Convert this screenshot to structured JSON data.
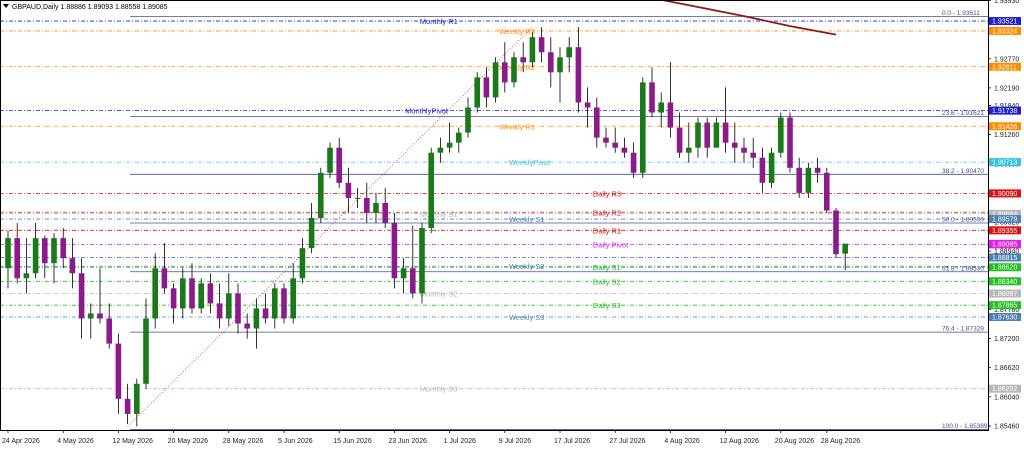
{
  "header": {
    "title": "GBPAUD,Daily  1.88886 1.89093 1.88558 1.89085"
  },
  "chart_data": {
    "type": "candlestick",
    "symbol": "GBPAUD",
    "timeframe": "Daily",
    "ylim": [
      1.8538,
      1.9394
    ],
    "y_ticks": [
      "1.93930",
      "1.93350",
      "1.92770",
      "1.92190",
      "1.91840",
      "1.91260",
      "1.90680",
      "1.90100",
      "1.89520",
      "1.88940",
      "1.88360",
      "1.87780",
      "1.87200",
      "1.86620",
      "1.86040",
      "1.85460"
    ],
    "x_labels": [
      "24 Apr 2026",
      "4 May 2026",
      "12 May 2026",
      "20 May 2026",
      "28 May 2026",
      "5 Jun 2026",
      "15 Jun 2026",
      "23 Jun 2026",
      "1 Jul 2026",
      "9 Jul 2026",
      "17 Jul 2026",
      "27 Jul 2026",
      "4 Aug 2026",
      "12 Aug 2026",
      "20 Aug 2026",
      "28 Aug 2026"
    ],
    "candles": [
      {
        "o": 1.886,
        "h": 1.8935,
        "l": 1.882,
        "c": 1.892
      },
      {
        "o": 1.892,
        "h": 1.895,
        "l": 1.883,
        "c": 1.884
      },
      {
        "o": 1.884,
        "h": 1.892,
        "l": 1.881,
        "c": 1.885
      },
      {
        "o": 1.885,
        "h": 1.895,
        "l": 1.884,
        "c": 1.892
      },
      {
        "o": 1.892,
        "h": 1.8925,
        "l": 1.884,
        "c": 1.887
      },
      {
        "o": 1.887,
        "h": 1.893,
        "l": 1.883,
        "c": 1.892
      },
      {
        "o": 1.892,
        "h": 1.894,
        "l": 1.886,
        "c": 1.888
      },
      {
        "o": 1.888,
        "h": 1.892,
        "l": 1.882,
        "c": 1.885
      },
      {
        "o": 1.885,
        "h": 1.888,
        "l": 1.872,
        "c": 1.876
      },
      {
        "o": 1.876,
        "h": 1.879,
        "l": 1.872,
        "c": 1.877
      },
      {
        "o": 1.877,
        "h": 1.886,
        "l": 1.875,
        "c": 1.876
      },
      {
        "o": 1.876,
        "h": 1.879,
        "l": 1.87,
        "c": 1.871
      },
      {
        "o": 1.871,
        "h": 1.873,
        "l": 1.857,
        "c": 1.86
      },
      {
        "o": 1.86,
        "h": 1.863,
        "l": 1.855,
        "c": 1.857
      },
      {
        "o": 1.857,
        "h": 1.864,
        "l": 1.8545,
        "c": 1.863
      },
      {
        "o": 1.863,
        "h": 1.88,
        "l": 1.862,
        "c": 1.876
      },
      {
        "o": 1.876,
        "h": 1.889,
        "l": 1.874,
        "c": 1.886
      },
      {
        "o": 1.886,
        "h": 1.891,
        "l": 1.881,
        "c": 1.882
      },
      {
        "o": 1.882,
        "h": 1.883,
        "l": 1.875,
        "c": 1.878
      },
      {
        "o": 1.878,
        "h": 1.886,
        "l": 1.876,
        "c": 1.884
      },
      {
        "o": 1.884,
        "h": 1.887,
        "l": 1.877,
        "c": 1.878
      },
      {
        "o": 1.878,
        "h": 1.884,
        "l": 1.877,
        "c": 1.883
      },
      {
        "o": 1.883,
        "h": 1.885,
        "l": 1.877,
        "c": 1.879
      },
      {
        "o": 1.879,
        "h": 1.883,
        "l": 1.874,
        "c": 1.876
      },
      {
        "o": 1.876,
        "h": 1.885,
        "l": 1.8745,
        "c": 1.881
      },
      {
        "o": 1.881,
        "h": 1.883,
        "l": 1.873,
        "c": 1.875
      },
      {
        "o": 1.875,
        "h": 1.877,
        "l": 1.872,
        "c": 1.874
      },
      {
        "o": 1.874,
        "h": 1.88,
        "l": 1.87,
        "c": 1.878
      },
      {
        "o": 1.878,
        "h": 1.881,
        "l": 1.875,
        "c": 1.876
      },
      {
        "o": 1.876,
        "h": 1.883,
        "l": 1.874,
        "c": 1.882
      },
      {
        "o": 1.882,
        "h": 1.883,
        "l": 1.875,
        "c": 1.876
      },
      {
        "o": 1.876,
        "h": 1.887,
        "l": 1.875,
        "c": 1.884
      },
      {
        "o": 1.884,
        "h": 1.892,
        "l": 1.883,
        "c": 1.89
      },
      {
        "o": 1.89,
        "h": 1.899,
        "l": 1.889,
        "c": 1.896
      },
      {
        "o": 1.896,
        "h": 1.906,
        "l": 1.895,
        "c": 1.905
      },
      {
        "o": 1.905,
        "h": 1.911,
        "l": 1.904,
        "c": 1.91
      },
      {
        "o": 1.91,
        "h": 1.912,
        "l": 1.902,
        "c": 1.903
      },
      {
        "o": 1.903,
        "h": 1.906,
        "l": 1.897,
        "c": 1.9
      },
      {
        "o": 1.9,
        "h": 1.902,
        "l": 1.898,
        "c": 1.9
      },
      {
        "o": 1.9,
        "h": 1.903,
        "l": 1.895,
        "c": 1.897
      },
      {
        "o": 1.897,
        "h": 1.901,
        "l": 1.895,
        "c": 1.899
      },
      {
        "o": 1.899,
        "h": 1.902,
        "l": 1.894,
        "c": 1.895
      },
      {
        "o": 1.895,
        "h": 1.897,
        "l": 1.882,
        "c": 1.884
      },
      {
        "o": 1.884,
        "h": 1.888,
        "l": 1.881,
        "c": 1.886
      },
      {
        "o": 1.886,
        "h": 1.8945,
        "l": 1.88,
        "c": 1.881
      },
      {
        "o": 1.881,
        "h": 1.895,
        "l": 1.879,
        "c": 1.894
      },
      {
        "o": 1.894,
        "h": 1.91,
        "l": 1.893,
        "c": 1.909
      },
      {
        "o": 1.909,
        "h": 1.912,
        "l": 1.907,
        "c": 1.91
      },
      {
        "o": 1.91,
        "h": 1.915,
        "l": 1.909,
        "c": 1.911
      },
      {
        "o": 1.911,
        "h": 1.914,
        "l": 1.909,
        "c": 1.913
      },
      {
        "o": 1.913,
        "h": 1.92,
        "l": 1.912,
        "c": 1.918
      },
      {
        "o": 1.918,
        "h": 1.925,
        "l": 1.917,
        "c": 1.924
      },
      {
        "o": 1.924,
        "h": 1.926,
        "l": 1.918,
        "c": 1.92
      },
      {
        "o": 1.92,
        "h": 1.928,
        "l": 1.919,
        "c": 1.927
      },
      {
        "o": 1.927,
        "h": 1.931,
        "l": 1.921,
        "c": 1.923
      },
      {
        "o": 1.923,
        "h": 1.929,
        "l": 1.922,
        "c": 1.928
      },
      {
        "o": 1.928,
        "h": 1.931,
        "l": 1.925,
        "c": 1.927
      },
      {
        "o": 1.927,
        "h": 1.933,
        "l": 1.926,
        "c": 1.932
      },
      {
        "o": 1.932,
        "h": 1.934,
        "l": 1.927,
        "c": 1.929
      },
      {
        "o": 1.929,
        "h": 1.932,
        "l": 1.922,
        "c": 1.925
      },
      {
        "o": 1.925,
        "h": 1.93,
        "l": 1.919,
        "c": 1.928
      },
      {
        "o": 1.928,
        "h": 1.932,
        "l": 1.925,
        "c": 1.93
      },
      {
        "o": 1.93,
        "h": 1.934,
        "l": 1.917,
        "c": 1.919
      },
      {
        "o": 1.919,
        "h": 1.922,
        "l": 1.914,
        "c": 1.918
      },
      {
        "o": 1.918,
        "h": 1.92,
        "l": 1.91,
        "c": 1.912
      },
      {
        "o": 1.912,
        "h": 1.914,
        "l": 1.91,
        "c": 1.911
      },
      {
        "o": 1.911,
        "h": 1.914,
        "l": 1.909,
        "c": 1.91
      },
      {
        "o": 1.91,
        "h": 1.912,
        "l": 1.908,
        "c": 1.909
      },
      {
        "o": 1.909,
        "h": 1.911,
        "l": 1.904,
        "c": 1.905
      },
      {
        "o": 1.905,
        "h": 1.924,
        "l": 1.904,
        "c": 1.923
      },
      {
        "o": 1.923,
        "h": 1.926,
        "l": 1.916,
        "c": 1.917
      },
      {
        "o": 1.917,
        "h": 1.921,
        "l": 1.914,
        "c": 1.919
      },
      {
        "o": 1.919,
        "h": 1.927,
        "l": 1.912,
        "c": 1.914
      },
      {
        "o": 1.914,
        "h": 1.917,
        "l": 1.908,
        "c": 1.909
      },
      {
        "o": 1.909,
        "h": 1.915,
        "l": 1.907,
        "c": 1.91
      },
      {
        "o": 1.91,
        "h": 1.916,
        "l": 1.908,
        "c": 1.915
      },
      {
        "o": 1.915,
        "h": 1.916,
        "l": 1.908,
        "c": 1.91
      },
      {
        "o": 1.91,
        "h": 1.916,
        "l": 1.91,
        "c": 1.915
      },
      {
        "o": 1.915,
        "h": 1.922,
        "l": 1.909,
        "c": 1.911
      },
      {
        "o": 1.911,
        "h": 1.915,
        "l": 1.907,
        "c": 1.91
      },
      {
        "o": 1.91,
        "h": 1.912,
        "l": 1.907,
        "c": 1.909
      },
      {
        "o": 1.909,
        "h": 1.912,
        "l": 1.906,
        "c": 1.908
      },
      {
        "o": 1.908,
        "h": 1.91,
        "l": 1.901,
        "c": 1.903
      },
      {
        "o": 1.903,
        "h": 1.91,
        "l": 1.902,
        "c": 1.909
      },
      {
        "o": 1.909,
        "h": 1.917,
        "l": 1.908,
        "c": 1.916
      },
      {
        "o": 1.916,
        "h": 1.917,
        "l": 1.905,
        "c": 1.906
      },
      {
        "o": 1.906,
        "h": 1.908,
        "l": 1.9,
        "c": 1.901
      },
      {
        "o": 1.901,
        "h": 1.907,
        "l": 1.9,
        "c": 1.906
      },
      {
        "o": 1.906,
        "h": 1.908,
        "l": 1.903,
        "c": 1.905
      },
      {
        "o": 1.905,
        "h": 1.906,
        "l": 1.897,
        "c": 1.8975
      },
      {
        "o": 1.8975,
        "h": 1.898,
        "l": 1.888,
        "c": 1.8888
      },
      {
        "o": 1.8889,
        "h": 1.8909,
        "l": 1.8856,
        "c": 1.8909
      }
    ],
    "moving_average": {
      "color": "#8b1a1a",
      "points": [
        {
          "i": 70,
          "v": 1.9398
        },
        {
          "i": 75,
          "v": 1.938
        },
        {
          "i": 80,
          "v": 1.9362
        },
        {
          "i": 85,
          "v": 1.9342
        },
        {
          "i": 90,
          "v": 1.9325
        }
      ]
    },
    "fibonacci": {
      "color": "#4b4b8f",
      "levels": [
        {
          "label": "0.0 - 1.93611",
          "value": 1.93611
        },
        {
          "label": "23.6 - 1.91621",
          "value": 1.91621
        },
        {
          "label": "38.2 - 1.90470",
          "value": 1.9047
        },
        {
          "label": "50.0 - 1.89500",
          "value": 1.895
        },
        {
          "label": "61.8 - 1.88530",
          "value": 1.8853
        },
        {
          "label": "76.4 - 1.87329",
          "value": 1.87329
        },
        {
          "label": "100.0 - 1.85389",
          "value": 1.85389
        }
      ]
    },
    "pivot_levels": [
      {
        "label": "Monthly R1",
        "value": 1.93521,
        "color": "#1f1fcf",
        "badge": "1.93521",
        "label_x": 0.425
      },
      {
        "label": "Weekly R3",
        "value": 1.93324,
        "color": "#ff8c00",
        "badge": "1.93324",
        "label_x": 0.505
      },
      {
        "label": "Weekly R2",
        "value": 1.92611,
        "color": "#ff8c00",
        "badge": "1.92611",
        "label_x": 0.505
      },
      {
        "label": "MonthlyPivot",
        "value": 1.91738,
        "color": "#1f1fcf",
        "badge": "1.91738",
        "label_x": 0.41
      },
      {
        "label": "Weekly R1",
        "value": 1.91426,
        "color": "#ff8c00",
        "badge": "1.91426",
        "label_x": 0.505
      },
      {
        "label": "WeeklyPivot",
        "value": 1.90713,
        "color": "#33c4e6",
        "badge": "1.90713",
        "label_x": 0.515
      },
      {
        "label": "Daily R3",
        "value": 1.9009,
        "color": "#e01010",
        "badge": "1.90090",
        "label_x": 0.6
      },
      {
        "label": "Daily R2",
        "value": 1.89714,
        "color": "#e01010",
        "badge": "",
        "label_x": 0.6
      },
      {
        "label": "Monthly S1",
        "value": 1.89684,
        "color": "#b8b8b8",
        "badge": "1.89684",
        "label_x": 0.425
      },
      {
        "label": "Weekly S1",
        "value": 1.89579,
        "color": "#4f7fb5",
        "badge": "1.89579",
        "label_x": 0.515
      },
      {
        "label": "Daily R1",
        "value": 1.89355,
        "color": "#e01010",
        "badge": "1.89355",
        "label_x": 0.6
      },
      {
        "label": "Daily Pivot",
        "value": 1.89075,
        "color": "#e020e0",
        "badge": "1.89075",
        "label_x": 0.6
      },
      {
        "label": "",
        "value": 1.88815,
        "color": "#4f7fb5",
        "badge": "1.88815",
        "label_x": 0.515
      },
      {
        "label": "Weekly S2",
        "value": 1.8864,
        "color": "#4f7fb5",
        "badge": "",
        "label_x": 0.515
      },
      {
        "label": "Daily S1",
        "value": 1.8862,
        "color": "#20c020",
        "badge": "1.88620",
        "label_x": 0.6
      },
      {
        "label": "Daily S2",
        "value": 1.8834,
        "color": "#20c020",
        "badge": "1.88340",
        "label_x": 0.6
      },
      {
        "label": "Monthly S2",
        "value": 1.88097,
        "color": "#b8b8b8",
        "badge": "1.88097",
        "label_x": 0.425
      },
      {
        "label": "Daily S3",
        "value": 1.87865,
        "color": "#20c020",
        "badge": "1.87865",
        "label_x": 0.6
      },
      {
        "label": "Weekly S3",
        "value": 1.8763,
        "color": "#4f7fb5",
        "badge": "1.87630",
        "label_x": 0.515
      },
      {
        "label": "Monthly S3",
        "value": 1.86202,
        "color": "#b8b8b8",
        "badge": "1.86202",
        "label_x": 0.425
      }
    ],
    "last_price": {
      "value": 1.89085,
      "color": "#1f1fcf"
    }
  }
}
